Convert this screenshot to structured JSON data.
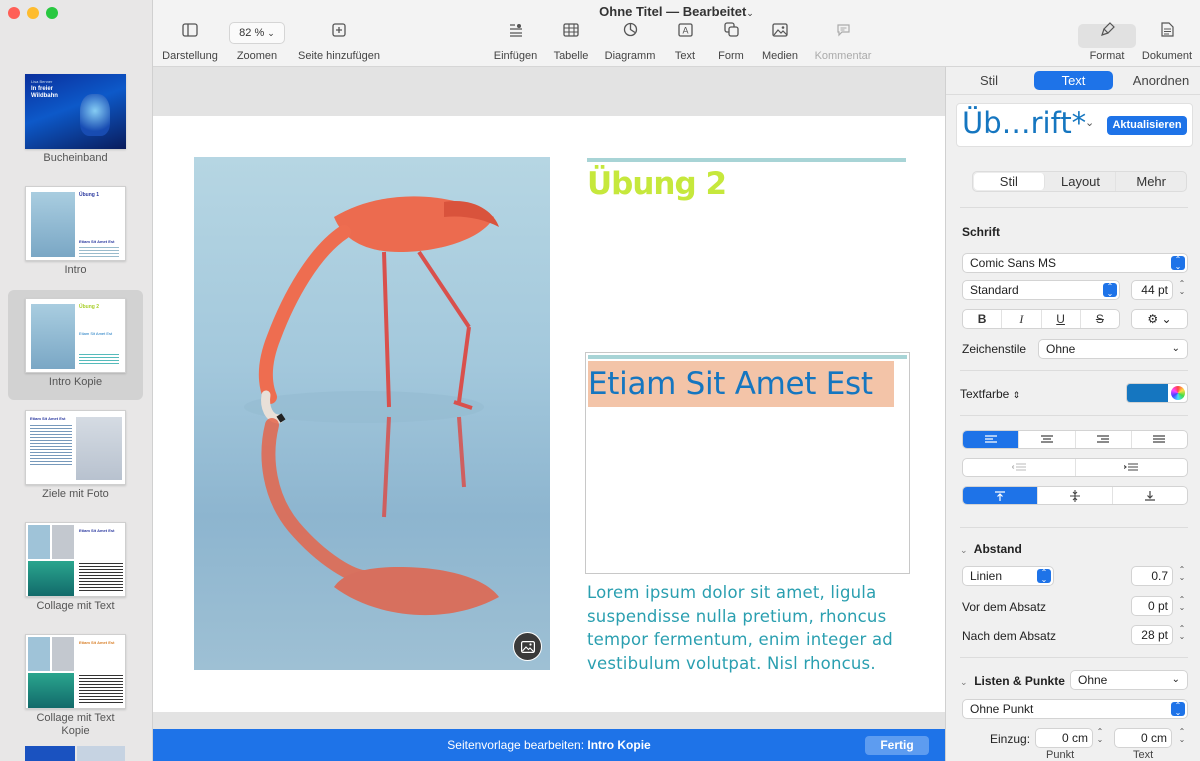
{
  "window": {
    "title": "Ohne Titel",
    "title_sep": "—",
    "status": "Bearbeitet"
  },
  "traffic_colors": {
    "close": "#ff5f57",
    "minimize": "#febc2e",
    "zoom": "#28c840"
  },
  "toolbar": {
    "darstellung": "Darstellung",
    "zoom_value": "82 %",
    "zoomen": "Zoomen",
    "seite_hinzufuegen": "Seite hinzufügen",
    "einfuegen": "Einfügen",
    "tabelle": "Tabelle",
    "diagramm": "Diagramm",
    "text": "Text",
    "form": "Form",
    "medien": "Medien",
    "kommentar": "Kommentar",
    "format": "Format",
    "dokument": "Dokument"
  },
  "sidebar": {
    "pages": [
      {
        "label": "Bucheinband",
        "cover_title": "In freier Wildbahn",
        "cover_small": "Lisa Benner"
      },
      {
        "label": "Intro",
        "heading": "Übung 1",
        "sub": "Etiam Sit Amet Est"
      },
      {
        "label": "Intro Kopie",
        "heading": "Übung 2",
        "sub": "Etiam Sit Amet Est"
      },
      {
        "label": "Ziele mit Foto",
        "heading": "Etiam Sit Amet Est"
      },
      {
        "label": "Collage mit Text",
        "heading": "Etiam Sit Amet Est"
      },
      {
        "label": "Collage mit Text",
        "label2": "Kopie",
        "heading": "Etiam Sit Amet Est"
      }
    ]
  },
  "page": {
    "heading": "Übung 2",
    "title_text": "Etiam Sit Amet Est",
    "body": "Lorem ipsum dolor sit amet, ligula suspendisse nulla pretium, rhoncus tempor fermentum, enim integer ad vestibulum volutpat. Nisl rhoncus.",
    "body_lines": [
      "Lorem ipsum dolor sit amet, ligula",
      "suspendisse nulla pretium, rhoncus",
      "tempor fermentum, enim integer ad",
      "vestibulum volutpat. Nisl rhoncus."
    ]
  },
  "editbar": {
    "label": "Seitenvorlage bearbeiten:",
    "name": "Intro Kopie",
    "done": "Fertig"
  },
  "inspector": {
    "tabs": [
      "Stil",
      "Text",
      "Anordnen"
    ],
    "active_tab": "Text",
    "para_style": "Üb…rift*",
    "update_btn": "Aktualisieren",
    "subtabs": [
      "Stil",
      "Layout",
      "Mehr"
    ],
    "schrift": "Schrift",
    "font": "Comic Sans MS",
    "typeface": "Standard",
    "size": "44 pt",
    "bold": "B",
    "italic": "I",
    "underline": "U",
    "strike": "S",
    "zeichenstile_label": "Zeichenstile",
    "zeichenstile_value": "Ohne",
    "textfarbe_label": "Textfarbe",
    "text_color": "#1576c0",
    "abstand": "Abstand",
    "linien": "Linien",
    "line_value": "0.7",
    "vor_label": "Vor dem Absatz",
    "vor_value": "0 pt",
    "nach_label": "Nach dem Absatz",
    "nach_value": "28 pt",
    "listen_label": "Listen & Punkte",
    "listen_value": "Ohne",
    "punkt_value": "Ohne Punkt",
    "einzug_label": "Einzug:",
    "punkt_indent": "0 cm",
    "text_indent": "0 cm",
    "punkt_label": "Punkt",
    "text_label": "Text"
  },
  "colors": {
    "accent": "#1e73e8",
    "lime": "#c6e83c",
    "teal_rule": "#a8d4d6",
    "highlight": "#f3c4a8",
    "body_teal": "#2a9fb0"
  }
}
